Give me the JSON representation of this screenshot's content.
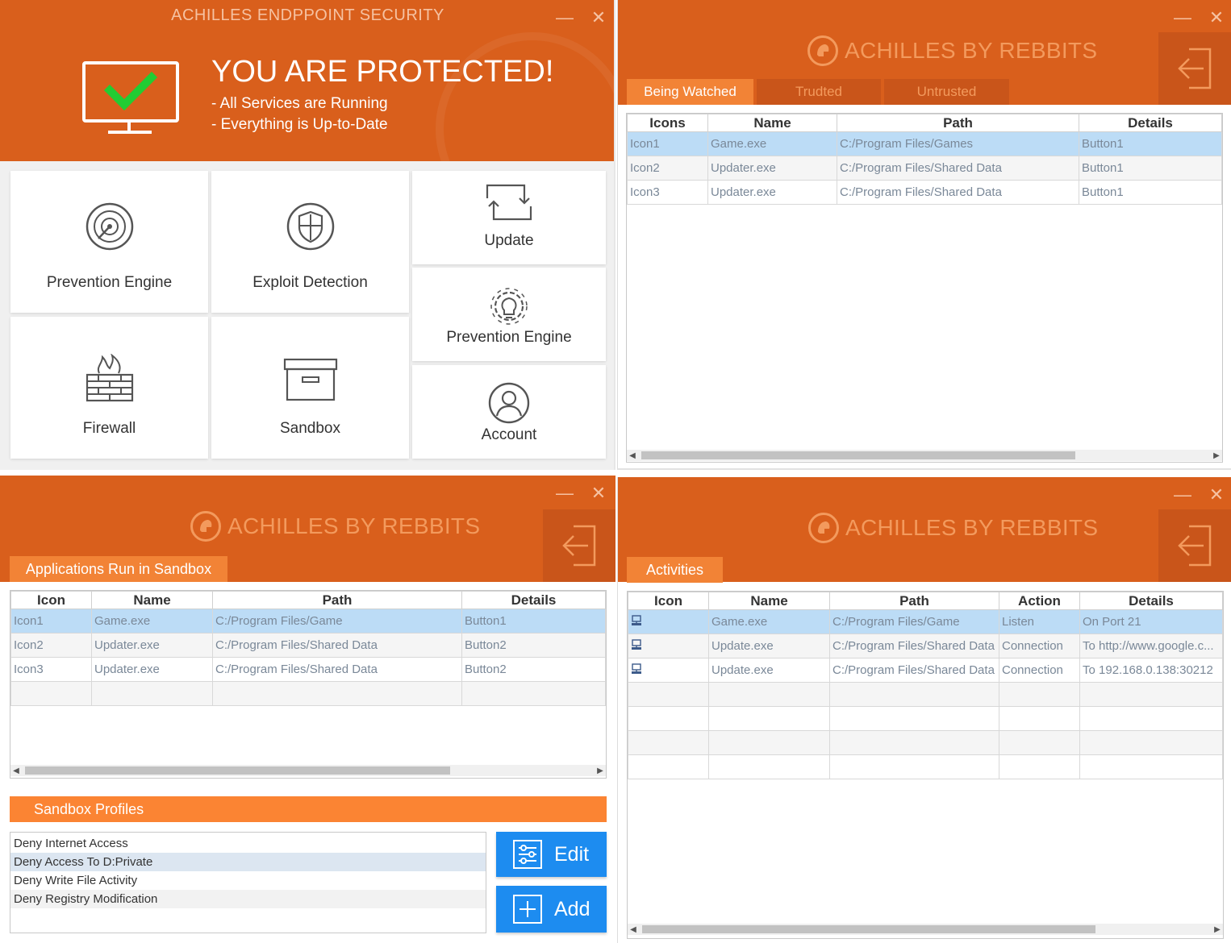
{
  "dashboard": {
    "app_title": "ACHILLES ENDPPOINT SECURITY",
    "status_title": "YOU ARE PROTECTED!",
    "status_lines": [
      "- All Services are Running",
      "- Everything is Up-to-Date"
    ],
    "tiles": [
      {
        "label": "Prevention Engine",
        "icon": "radar-icon"
      },
      {
        "label": "Exploit Detection",
        "icon": "shield-icon"
      },
      {
        "label": "Update",
        "icon": "refresh-icon"
      },
      {
        "label": "Prevention Engine",
        "icon": "gear-bulb-icon"
      },
      {
        "label": "Firewall",
        "icon": "firewall-icon"
      },
      {
        "label": "Sandbox",
        "icon": "box-icon"
      },
      {
        "label": "Account",
        "icon": "user-icon"
      }
    ]
  },
  "brand_name": "ACHILLES BY  REBBITS",
  "window_controls": {
    "minimize": "—",
    "close": "✕"
  },
  "watch": {
    "tabs": [
      "Being Watched",
      "Trudted",
      "Untrusted"
    ],
    "columns": [
      "Icons",
      "Name",
      "Path",
      "Details"
    ],
    "rows": [
      [
        "Icon1",
        "Game.exe",
        "C:/Program Files/Games",
        "Button1"
      ],
      [
        "Icon2",
        "Updater.exe",
        "C:/Program Files/Shared Data",
        "Button1"
      ],
      [
        "Icon3",
        "Updater.exe",
        "C:/Program Files/Shared Data",
        "Button1"
      ]
    ]
  },
  "sandbox": {
    "tab": "Applications Run in Sandbox",
    "columns": [
      "Icon",
      "Name",
      "Path",
      "Details"
    ],
    "rows": [
      [
        "Icon1",
        "Game.exe",
        "C:/Program Files/Game",
        "Button1"
      ],
      [
        "Icon2",
        "Updater.exe",
        "C:/Program Files/Shared Data",
        "Button2"
      ],
      [
        "Icon3",
        "Updater.exe",
        "C:/Program Files/Shared Data",
        "Button2"
      ],
      [
        "",
        "",
        "",
        ""
      ]
    ],
    "profiles_title": "Sandbox Profiles",
    "profiles": [
      "Deny Internet Access",
      "Deny Access To D:Private",
      "Deny Write File Activity",
      "Deny Registry Modification"
    ],
    "edit_label": "Edit",
    "add_label": "Add"
  },
  "activities": {
    "tab": "Activities",
    "columns": [
      "Icon",
      "Name",
      "Path",
      "Action",
      "Details"
    ],
    "rows": [
      [
        "",
        "Game.exe",
        "C:/Program Files/Game",
        "Listen",
        "On Port 21"
      ],
      [
        "",
        "Update.exe",
        "C:/Program Files/Shared Data",
        "Connection",
        "To http://www.google.c..."
      ],
      [
        "",
        "Update.exe",
        "C:/Program Files/Shared Data",
        "Connection",
        "To 192.168.0.138:30212"
      ],
      [
        "",
        "",
        "",
        "",
        ""
      ],
      [
        "",
        "",
        "",
        "",
        ""
      ],
      [
        "",
        "",
        "",
        "",
        ""
      ],
      [
        "",
        "",
        "",
        "",
        ""
      ]
    ]
  }
}
